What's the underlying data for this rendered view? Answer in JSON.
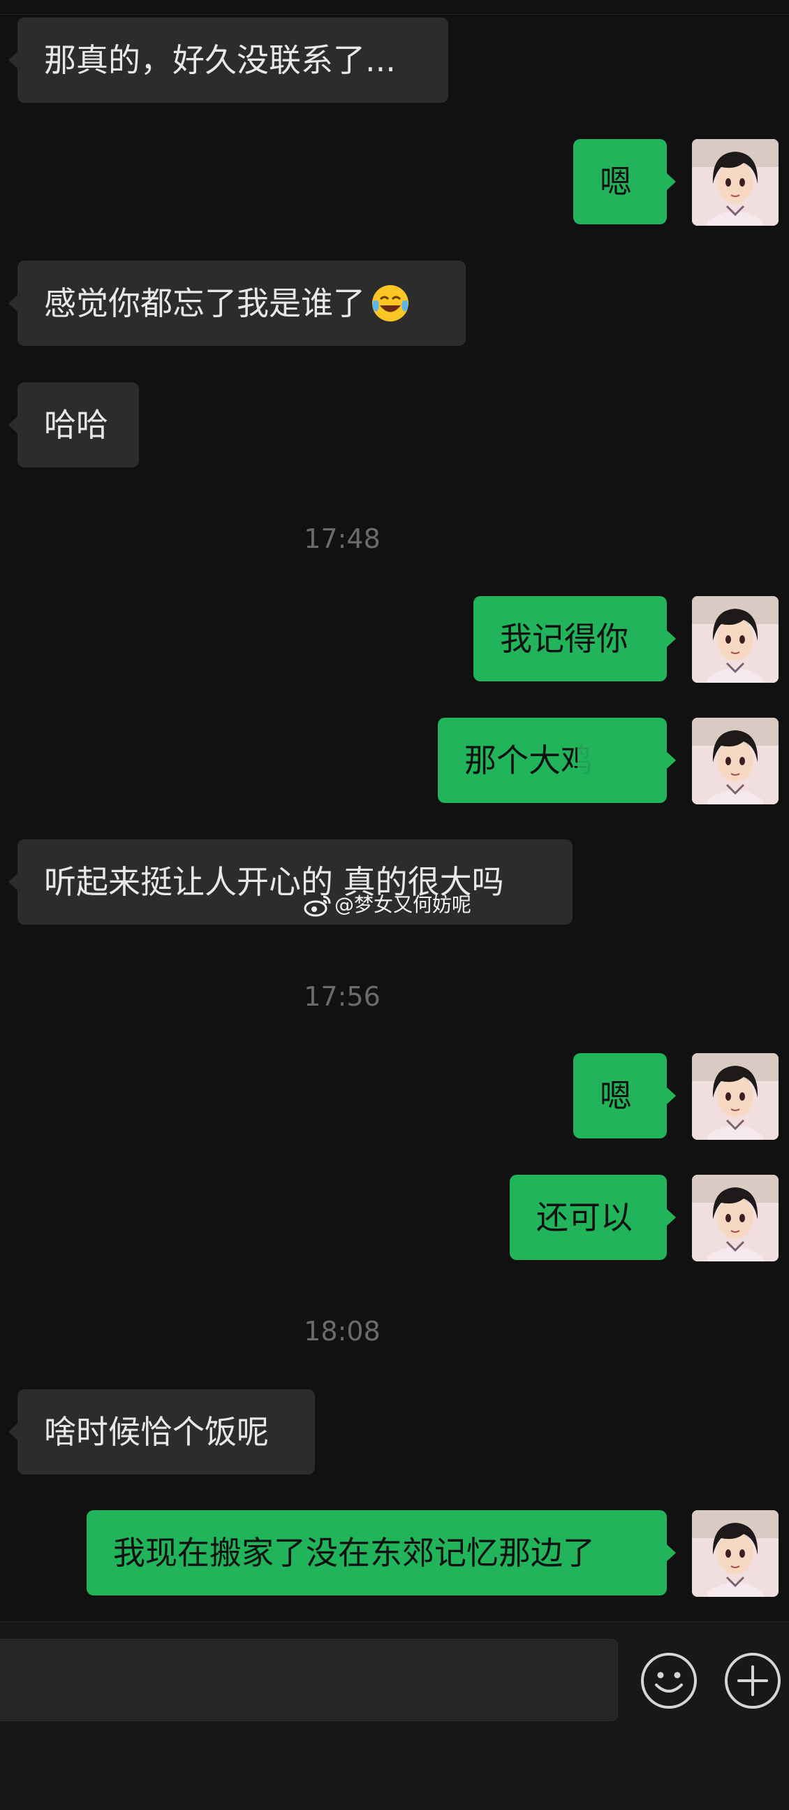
{
  "messages": [
    {
      "text": "那真的，好久没联系了..."
    },
    {
      "text": "嗯"
    },
    {
      "text": "感觉你都忘了我是谁了"
    },
    {
      "text": "哈哈"
    },
    {
      "text": "我记得你"
    },
    {
      "text": "那个大鸡"
    },
    {
      "text": "听起来挺让人开心的 真的很大吗"
    },
    {
      "text": "嗯"
    },
    {
      "text": "还可以"
    },
    {
      "text": "啥时候恰个饭呢"
    },
    {
      "text": "我现在搬家了没在东郊记忆那边了"
    }
  ],
  "timestamps": [
    "17:48",
    "17:56",
    "18:08"
  ],
  "watermark": "@梦女又何妨呢",
  "icons": {
    "emoji_inline": "tears-of-joy-emoji",
    "emoji_button": "smiley-icon",
    "plus_button": "plus-circle-icon",
    "avatar": "anime-girl-avatar"
  },
  "colors": {
    "background": "#111111",
    "incoming_bubble": "#2c2c2c",
    "outgoing_bubble": "#21b45a",
    "timestamp": "#6b6b6b"
  }
}
